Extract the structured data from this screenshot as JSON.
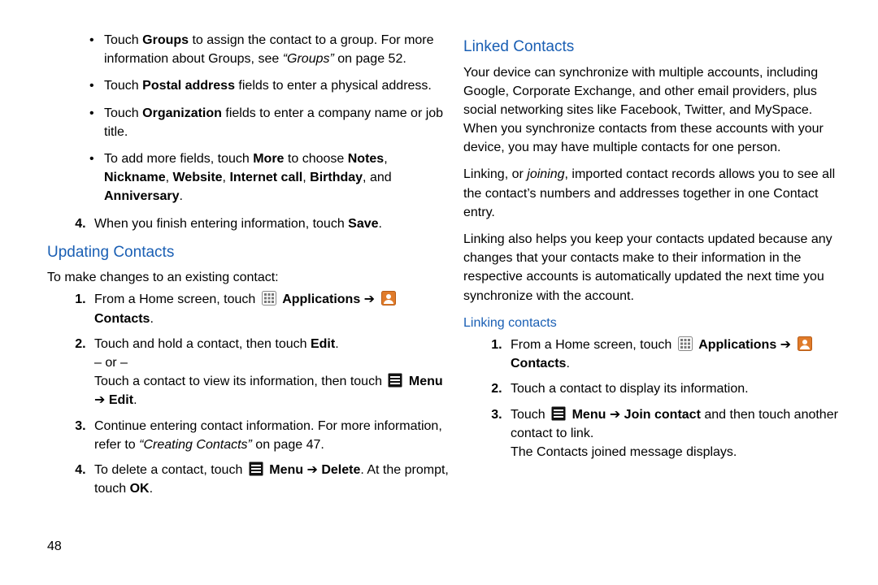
{
  "page_number": "48",
  "left": {
    "bullets": [
      {
        "text": "Touch <b>Groups</b> to assign the contact to a group. For more information about Groups, see <i>“Groups”</i> on page 52."
      },
      {
        "text": "Touch <b>Postal address</b> fields to enter a physical address."
      },
      {
        "text": "Touch <b>Organization</b> fields to enter a company name or job title."
      },
      {
        "text": "To add more fields, touch <b>More</b> to choose <b>Notes</b>, <b>Nickname</b>, <b>Website</b>, <b>Internet call</b>, <b>Birthday</b>, and <b>Anniversary</b>."
      }
    ],
    "step4_top": "When you finish entering information, touch <b>Save</b>.",
    "h2_updating": "Updating Contacts",
    "updating_intro": "To make changes to an existing contact:",
    "updating_steps": {
      "s1_pre": "From a Home screen, touch ",
      "s1_apps": " <b>Applications</b>",
      "s1_arrow": " ➔ ",
      "s1_contacts": " <b>Contacts</b>.",
      "s2_a": "Touch and hold a contact, then touch <b>Edit</b>.",
      "s2_or": "– or –",
      "s2_b_pre": "Touch a contact to view its information, then touch ",
      "s2_b_menu": " <b>Menu</b> ➔ <b>Edit</b>.",
      "s3": "Continue entering contact information. For more information, refer to <i>“Creating Contacts”</i>  on page 47.",
      "s4_pre": "To delete a contact, touch ",
      "s4_mid": " <b>Menu</b> ➔ <b>Delete</b>. At the prompt, touch <b>OK</b>."
    }
  },
  "right": {
    "h2_linked": "Linked Contacts",
    "p1": "Your device can synchronize with multiple accounts, including Google, Corporate Exchange, and other email providers, plus social networking sites like Facebook, Twitter, and MySpace. When you synchronize contacts from these accounts with your device, you may have multiple contacts for one person.",
    "p2": "Linking, or <i>joining</i>, imported contact records allows you to see all the contact’s numbers and addresses together in one Contact entry.",
    "p3": "Linking also helps you keep your contacts updated because any changes that your contacts make to their information in the respective accounts is automatically updated the next time you synchronize with the account.",
    "h3_linking": "Linking contacts",
    "linking_steps": {
      "s1_pre": "From a Home screen, touch ",
      "s1_apps": " <b>Applications</b>",
      "s1_arrow": " ➔ ",
      "s1_contacts": " <b>Contacts</b>.",
      "s2": "Touch a contact to display its information.",
      "s3_pre": "Touch ",
      "s3_mid": " <b>Menu</b> ➔ <b>Join contact</b> and then touch another contact to link.",
      "s3_after": "The Contacts joined message displays."
    }
  },
  "chart_data": {
    "type": "table",
    "note": "document page — no chart"
  }
}
